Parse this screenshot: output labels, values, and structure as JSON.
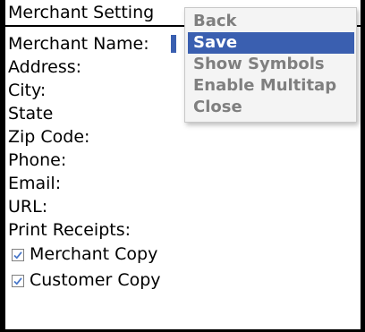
{
  "title": "Merchant Setting",
  "fields": [
    {
      "label": "Merchant Name:"
    },
    {
      "label": "Address:"
    },
    {
      "label": "City:"
    },
    {
      "label": "State"
    },
    {
      "label": "Zip Code:"
    },
    {
      "label": "Phone:"
    },
    {
      "label": "Email:"
    },
    {
      "label": "URL:"
    },
    {
      "label": "Print Receipts:"
    }
  ],
  "checkboxes": [
    {
      "label": "Merchant Copy",
      "checked": true
    },
    {
      "label": "Customer Copy",
      "checked": true
    }
  ],
  "menu": {
    "items": [
      {
        "label": "Back",
        "selected": false
      },
      {
        "label": "Save",
        "selected": true
      },
      {
        "label": "Show Symbols",
        "selected": false
      },
      {
        "label": "Enable Multitap",
        "selected": false
      },
      {
        "label": "Close",
        "selected": false
      }
    ]
  },
  "colors": {
    "selection": "#3a5fb0",
    "menu_text": "#7f7f7f",
    "menu_bg": "#f4f4f4",
    "check_mark": "#4a78c9"
  },
  "icons": {
    "checkbox": "checkmark-icon"
  }
}
